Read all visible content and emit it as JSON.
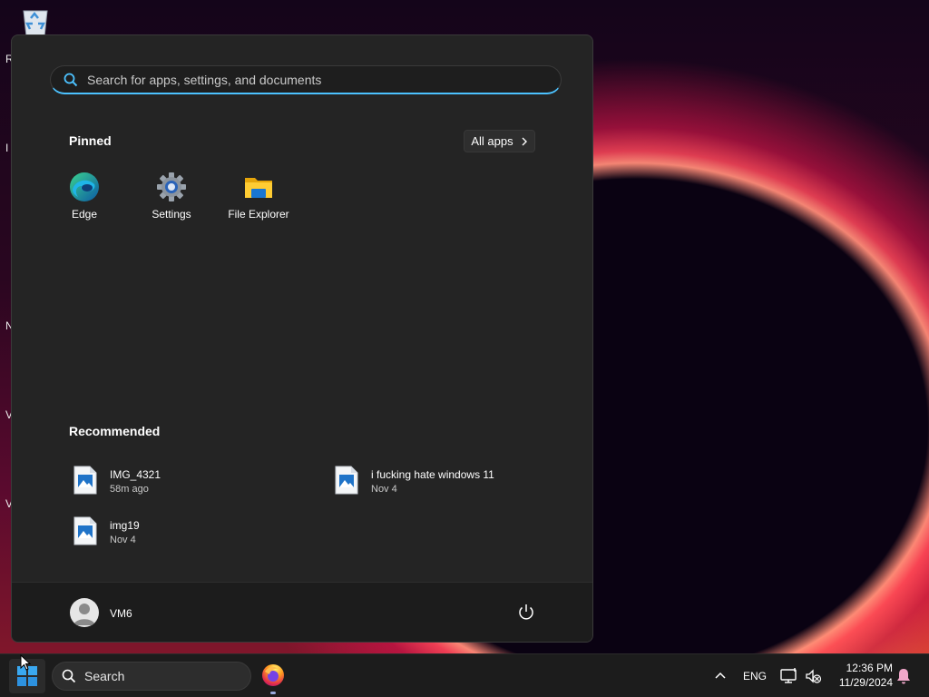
{
  "start_menu": {
    "search_placeholder": "Search for apps, settings, and documents",
    "pinned_title": "Pinned",
    "all_apps_label": "All apps",
    "pinned": [
      {
        "label": "Edge",
        "icon": "edge-icon"
      },
      {
        "label": "Settings",
        "icon": "settings-gear-icon"
      },
      {
        "label": "File Explorer",
        "icon": "folder-icon"
      }
    ],
    "recommended_title": "Recommended",
    "recommended": [
      {
        "name": "IMG_4321",
        "time": "58m ago",
        "icon": "image-file-icon"
      },
      {
        "name": "i fucking hate windows 11",
        "time": "Nov 4",
        "icon": "image-file-icon"
      },
      {
        "name": "img19",
        "time": "Nov 4",
        "icon": "image-file-icon"
      }
    ],
    "user": {
      "name": "VM6"
    }
  },
  "taskbar": {
    "search_label": "Search",
    "language": "ENG",
    "time": "12:36 PM",
    "date": "11/29/2024"
  },
  "desktop": {
    "left_edge_letters": [
      "R",
      "I",
      "N",
      "V",
      "V"
    ]
  },
  "colors": {
    "accent": "#4cc2ff",
    "menu_bg": "#242424",
    "taskbar_bg": "#1c1c1c"
  }
}
